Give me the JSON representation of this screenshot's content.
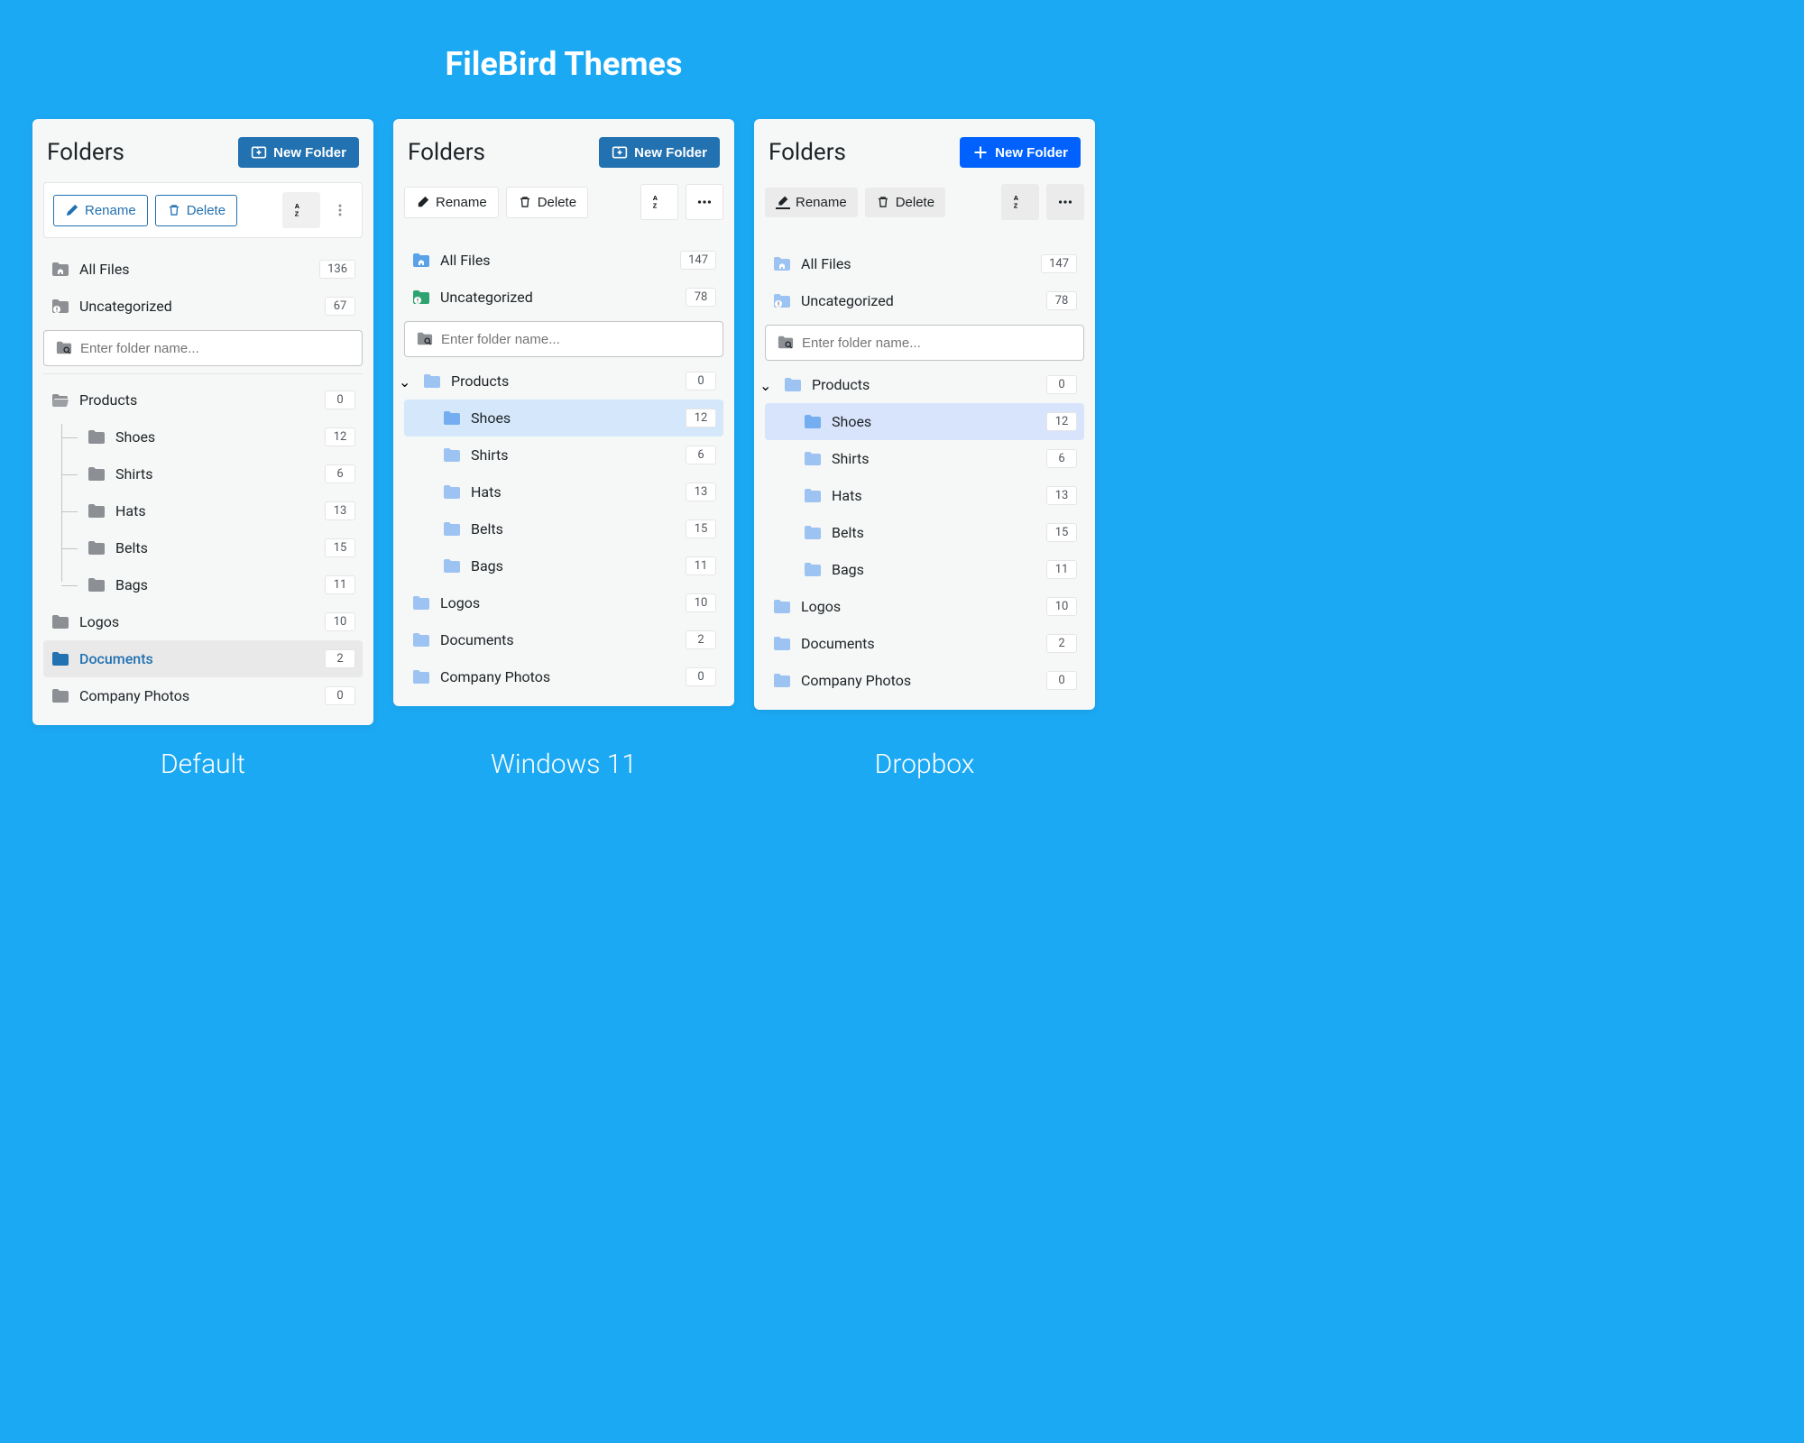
{
  "page_title": "FileBird Themes",
  "common": {
    "panel_title": "Folders",
    "new_folder_label": "New Folder",
    "rename_label": "Rename",
    "delete_label": "Delete",
    "search_placeholder": "Enter folder name...",
    "all_files_label": "All Files",
    "uncategorized_label": "Uncategorized"
  },
  "themes": [
    {
      "name": "Default"
    },
    {
      "name": "Windows 11"
    },
    {
      "name": "Dropbox"
    }
  ],
  "panel_default": {
    "all_files_count": 136,
    "uncategorized_count": 67,
    "folders": [
      {
        "label": "Products",
        "count": 0
      },
      {
        "label": "Shoes",
        "count": 12
      },
      {
        "label": "Shirts",
        "count": 6
      },
      {
        "label": "Hats",
        "count": 13
      },
      {
        "label": "Belts",
        "count": 15
      },
      {
        "label": "Bags",
        "count": 11
      },
      {
        "label": "Logos",
        "count": 10
      },
      {
        "label": "Documents",
        "count": 2
      },
      {
        "label": "Company Photos",
        "count": 0
      }
    ]
  },
  "panel_light": {
    "all_files_count": 147,
    "uncategorized_count": 78,
    "folders": [
      {
        "label": "Products",
        "count": 0
      },
      {
        "label": "Shoes",
        "count": 12
      },
      {
        "label": "Shirts",
        "count": 6
      },
      {
        "label": "Hats",
        "count": 13
      },
      {
        "label": "Belts",
        "count": 15
      },
      {
        "label": "Bags",
        "count": 11
      },
      {
        "label": "Logos",
        "count": 10
      },
      {
        "label": "Documents",
        "count": 2
      },
      {
        "label": "Company Photos",
        "count": 0
      }
    ]
  }
}
